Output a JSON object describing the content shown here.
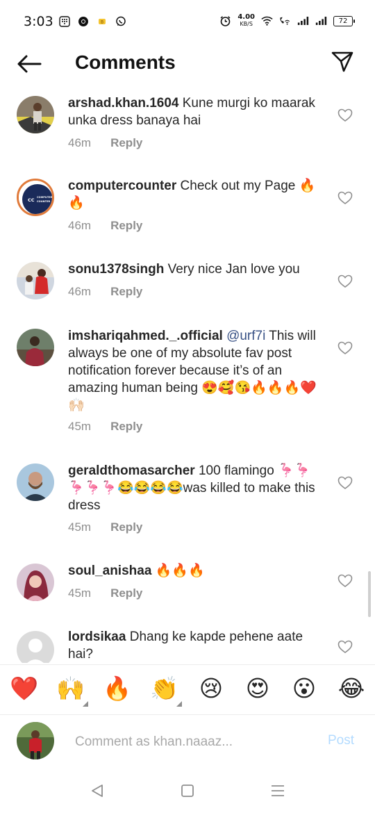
{
  "status": {
    "time": "3:03",
    "net_speed": "4.00",
    "net_unit": "KB/S",
    "battery": "72",
    "icons": [
      "dialpad-icon",
      "chrome-icon",
      "app-notification-icon",
      "whatsapp-icon",
      "alarm-icon",
      "wifi-icon",
      "vowifi-call-icon",
      "signal-icon"
    ]
  },
  "header": {
    "title": "Comments",
    "back_icon": "arrow-left-icon",
    "share_icon": "paper-plane-icon"
  },
  "comments": [
    {
      "user": "arshad.khan.1604",
      "mention": "",
      "text": " Kune murgi ko maarak unka dress banaya hai",
      "time": "46m",
      "reply": "Reply",
      "avatar": "photo"
    },
    {
      "user": "computercounter",
      "mention": "",
      "text": " Check out my Page 🔥🔥",
      "time": "46m",
      "reply": "Reply",
      "avatar": "logo",
      "avatar_logo_initials": "CC",
      "avatar_logo_text": "COMPUTER COUNTER"
    },
    {
      "user": "sonu1378singh",
      "mention": "",
      "text": " Very nice Jan love you",
      "time": "46m",
      "reply": "Reply",
      "avatar": "photo"
    },
    {
      "user": "imshariqahmed._.official",
      "mention": " @urf7i",
      "text": " This will always be one of my absolute fav post notification forever because it’s of an amazing human being 😍🥰😘🔥🔥🔥❤️🙌🏻",
      "time": "45m",
      "reply": "Reply",
      "avatar": "photo"
    },
    {
      "user": "geraldthomasarcher",
      "mention": "",
      "text": " 100  flamingo 🦩🦩🦩🦩🦩😂😂😂😂was killed to make this dress",
      "time": "45m",
      "reply": "Reply",
      "avatar": "photo"
    },
    {
      "user": "soul_anishaa",
      "mention": "",
      "text": " 🔥🔥🔥",
      "time": "45m",
      "reply": "Reply",
      "avatar": "photo"
    },
    {
      "user": "lordsikaa",
      "mention": "",
      "text": " Dhang ke kapde pehene aate hai?",
      "time": "",
      "reply": "",
      "avatar": "default"
    }
  ],
  "emoji_bar": [
    "❤️",
    "🙌",
    "🔥",
    "👏",
    "😢",
    "😍",
    "😮",
    "😂"
  ],
  "input": {
    "placeholder": "Comment as khan.naaaz...",
    "post_label": "Post"
  },
  "nav": {
    "icons": [
      "back-triangle-icon",
      "home-square-icon",
      "recents-lines-icon"
    ]
  },
  "colors": {
    "mention": "#385185",
    "meta": "#8e8e8e",
    "post_disabled": "#b3dbff",
    "heart": "#e0245e"
  }
}
